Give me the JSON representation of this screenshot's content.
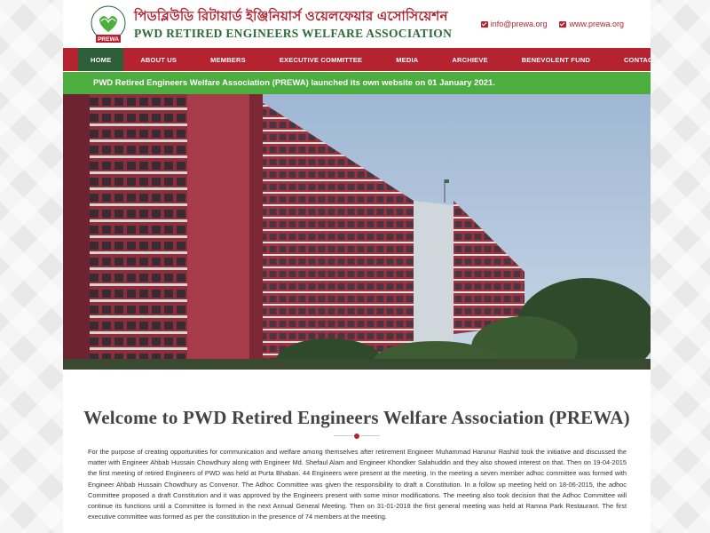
{
  "header": {
    "logo_text": "PREWA",
    "logo_ring_text": "PWD RETIRED ENGINEERS WELFARE ASSOCIATION",
    "title_bn": "পিডব্লিউডি রিটায়ার্ড ইঞ্জিনিয়ার্স ওয়েলফেয়ার এসোসিয়েশন",
    "title_en": "PWD RETIRED ENGINEERS WELFARE ASSOCIATION",
    "email": "info@prewa.org",
    "website": "www.prewa.org"
  },
  "nav": {
    "items": [
      {
        "label": "HOME"
      },
      {
        "label": "ABOUT US"
      },
      {
        "label": "MEMBERS"
      },
      {
        "label": "EXECUTIVE COMMITTEE"
      },
      {
        "label": "MEDIA"
      },
      {
        "label": "ARCHIEVE"
      },
      {
        "label": "BENEVOLENT FUND"
      },
      {
        "label": "CONTACT US"
      }
    ],
    "active": "HOME"
  },
  "notice": "PWD Retired Engineers Welfare Association (PREWA) launched its own website on 01 January 2021.",
  "main": {
    "heading": "Welcome to PWD Retired Engineers Welfare Association (PREWA)",
    "paragraph": "For the purpose of creating opportunities for communication and welfare among themselves after retirement Engineer Muhammad Harunur Rashid took the initiative and discussed the matter with Engineer Ahbab Hussain Chowdhury along with Engineer Md. Shefaul Alam and Engineer Khondker Salahuddin and they also showed interest on that. Then on 19-04-2015 the first meeting of retired Engineers of PWD was held at Purta Bhaban. 44 Engineers were present at the meeting. In the meeting a seven member adhoc committee was formed with Engineer Ahbab Hussain Chowdhury as Convenor. The Adhoc Committee was given the responsibility to draft a Constitution. In a follow up meeting held on 18-06-2015, the adhoc Committee proposed a draft Constitution and it was approved by the Engineers present with some minor modifications. The meeting also took decision that the Adhoc Committee will continue its functions until a Committee is formed in the next Annual General Meeting. Then on 31-01-2018 the first general meeting was held at Ramna Park Restaurant. The first executive committee was formed as per the constitution in the presence of 74 members at the meeting."
  },
  "colors": {
    "brand_red": "#b4232f",
    "brand_green": "#2c5e37",
    "notice_green": "#4cae3f"
  },
  "icons": {
    "email": "envelope-icon",
    "website": "envelope-icon"
  }
}
